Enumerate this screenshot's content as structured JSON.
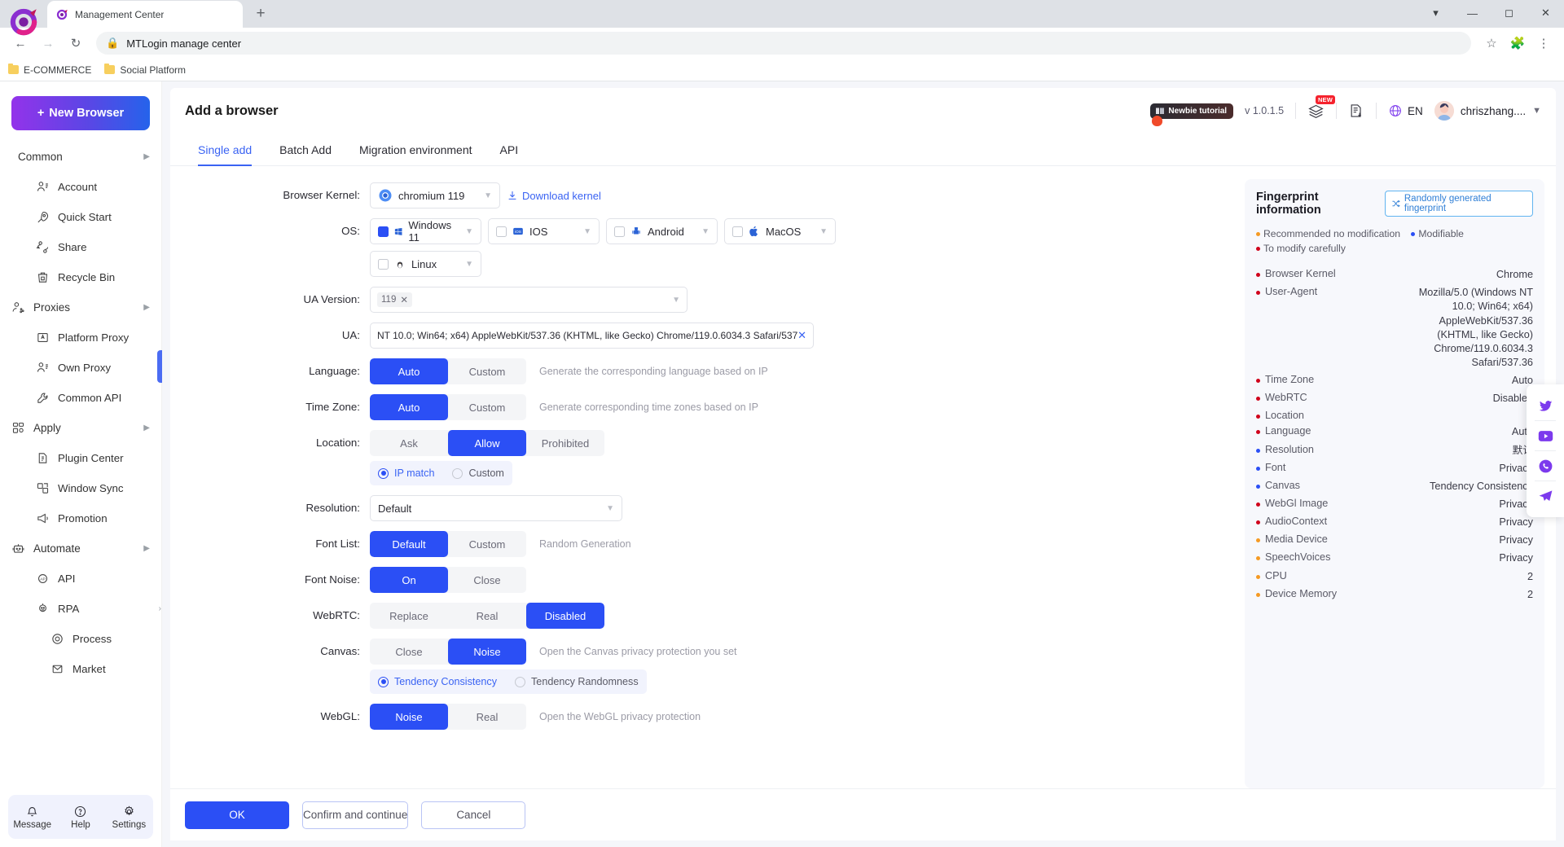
{
  "browser": {
    "tab_title": "Management Center",
    "new_tab_label": "+",
    "url": "MTLogin manage center",
    "bookmarks": [
      {
        "label": "E-COMMERCE"
      },
      {
        "label": "Social Platform"
      }
    ]
  },
  "sidebar": {
    "new_browser_label": "New Browser",
    "items": [
      {
        "label": "Common",
        "level": "group",
        "icon": "none",
        "expandable": true
      },
      {
        "label": "Account",
        "level": "item",
        "icon": "account-icon"
      },
      {
        "label": "Quick Start",
        "level": "item",
        "icon": "rocket-icon"
      },
      {
        "label": "Share",
        "level": "item",
        "icon": "share-icon"
      },
      {
        "label": "Recycle Bin",
        "level": "item",
        "icon": "recycle-bin-icon"
      },
      {
        "label": "Proxies",
        "level": "group",
        "icon": "proxies-icon",
        "expandable": true
      },
      {
        "label": "Platform Proxy",
        "level": "item",
        "icon": "platform-proxy-icon"
      },
      {
        "label": "Own Proxy",
        "level": "item",
        "icon": "own-proxy-icon"
      },
      {
        "label": "Common API",
        "level": "item",
        "icon": "wrench-icon"
      },
      {
        "label": "Apply",
        "level": "group",
        "icon": "apply-icon",
        "expandable": true
      },
      {
        "label": "Plugin Center",
        "level": "item",
        "icon": "plugin-icon"
      },
      {
        "label": "Window Sync",
        "level": "item",
        "icon": "window-sync-icon"
      },
      {
        "label": "Promotion",
        "level": "item",
        "icon": "megaphone-icon"
      },
      {
        "label": "Automate",
        "level": "group",
        "icon": "robot-icon",
        "expandable": true
      },
      {
        "label": "API",
        "level": "item",
        "icon": "api-icon"
      },
      {
        "label": "RPA",
        "level": "item",
        "icon": "rpa-icon",
        "expandable": true
      },
      {
        "label": "Process",
        "level": "lvl3",
        "icon": "process-icon"
      },
      {
        "label": "Market",
        "level": "lvl3",
        "icon": "market-icon"
      }
    ],
    "footer": [
      {
        "label": "Message",
        "icon": "bell-icon"
      },
      {
        "label": "Help",
        "icon": "question-icon"
      },
      {
        "label": "Settings",
        "icon": "gear-icon"
      }
    ]
  },
  "header": {
    "title": "Add a browser",
    "tutorial_label": "Newbie tutorial",
    "version": "v 1.0.1.5",
    "stack_badge": "NEW",
    "language": "EN",
    "user": "chriszhang...."
  },
  "tabs": [
    {
      "label": "Single add",
      "active": true
    },
    {
      "label": "Batch Add",
      "active": false
    },
    {
      "label": "Migration environment",
      "active": false
    },
    {
      "label": "API",
      "active": false
    }
  ],
  "form": {
    "browser_kernel": {
      "label": "Browser Kernel:",
      "value": "chromium 119",
      "download_label": "Download kernel"
    },
    "os": {
      "label": "OS:",
      "options": [
        {
          "name": "Windows 11",
          "checked": true,
          "icon": "windows-icon"
        },
        {
          "name": "IOS",
          "checked": false,
          "icon": "ios-icon"
        },
        {
          "name": "Android",
          "checked": false,
          "icon": "android-icon"
        },
        {
          "name": "MacOS",
          "checked": false,
          "icon": "apple-icon"
        },
        {
          "name": "Linux",
          "checked": false,
          "icon": "linux-icon"
        }
      ]
    },
    "ua_version": {
      "label": "UA Version:",
      "tag": "119"
    },
    "ua": {
      "label": "UA:",
      "value": "NT 10.0; Win64; x64) AppleWebKit/537.36 (KHTML, like Gecko) Chrome/119.0.6034.3 Safari/537.36"
    },
    "language": {
      "label": "Language:",
      "options": [
        "Auto",
        "Custom"
      ],
      "selected": "Auto",
      "hint": "Generate the corresponding language based on IP"
    },
    "timezone": {
      "label": "Time Zone:",
      "options": [
        "Auto",
        "Custom"
      ],
      "selected": "Auto",
      "hint": "Generate corresponding time zones based on IP"
    },
    "location": {
      "label": "Location:",
      "options": [
        "Ask",
        "Allow",
        "Prohibited"
      ],
      "selected": "Allow"
    },
    "location_mode": {
      "options": [
        "IP match",
        "Custom"
      ],
      "selected": "IP match"
    },
    "resolution": {
      "label": "Resolution:",
      "value": "Default"
    },
    "font_list": {
      "label": "Font List:",
      "options": [
        "Default",
        "Custom"
      ],
      "selected": "Default",
      "hint": "Random Generation"
    },
    "font_noise": {
      "label": "Font Noise:",
      "options": [
        "On",
        "Close"
      ],
      "selected": "On"
    },
    "webrtc": {
      "label": "WebRTC:",
      "options": [
        "Replace",
        "Real",
        "Disabled"
      ],
      "selected": "Disabled"
    },
    "canvas": {
      "label": "Canvas:",
      "options": [
        "Close",
        "Noise"
      ],
      "selected": "Noise",
      "hint": "Open the Canvas privacy protection you set"
    },
    "canvas_mode": {
      "options": [
        "Tendency Consistency",
        "Tendency Randomness"
      ],
      "selected": "Tendency Consistency"
    },
    "webgl": {
      "label": "WebGL:",
      "options": [
        "Noise",
        "Real"
      ],
      "selected": "Noise",
      "hint": "Open the WebGL privacy protection"
    }
  },
  "fingerprint": {
    "title": "Fingerprint information",
    "random_button": "Randomly generated fingerprint",
    "legend": [
      {
        "text": "Recommended no modification",
        "color": "#f59a23"
      },
      {
        "text": "Modifiable",
        "color": "#2b4ff5"
      },
      {
        "text": "To modify carefully",
        "color": "#d0021b"
      }
    ],
    "rows": [
      {
        "key": "Browser Kernel",
        "value": "Chrome",
        "color": "#d0021b"
      },
      {
        "key": "User-Agent",
        "value": "Mozilla/5.0 (Windows NT 10.0; Win64; x64) AppleWebKit/537.36 (KHTML, like Gecko) Chrome/119.0.6034.3 Safari/537.36",
        "color": "#d0021b"
      },
      {
        "key": "Time Zone",
        "value": "Auto",
        "color": "#d0021b"
      },
      {
        "key": "WebRTC",
        "value": "Disabled",
        "color": "#d0021b"
      },
      {
        "key": "Location",
        "value": "",
        "color": "#d0021b"
      },
      {
        "key": "Language",
        "value": "Auto",
        "color": "#d0021b"
      },
      {
        "key": "Resolution",
        "value": "默认",
        "color": "#2b4ff5"
      },
      {
        "key": "Font",
        "value": "Privacy",
        "color": "#2b4ff5"
      },
      {
        "key": "Canvas",
        "value": "Tendency Consistency",
        "color": "#2b4ff5"
      },
      {
        "key": "WebGl Image",
        "value": "Privacy",
        "color": "#d0021b"
      },
      {
        "key": "AudioContext",
        "value": "Privacy",
        "color": "#d0021b"
      },
      {
        "key": "Media Device",
        "value": "Privacy",
        "color": "#f59a23"
      },
      {
        "key": "SpeechVoices",
        "value": "Privacy",
        "color": "#f59a23"
      },
      {
        "key": "CPU",
        "value": "2",
        "color": "#f59a23"
      },
      {
        "key": "Device Memory",
        "value": "2",
        "color": "#f59a23"
      }
    ]
  },
  "social": [
    {
      "icon": "twitter-icon"
    },
    {
      "icon": "youtube-icon"
    },
    {
      "icon": "whatsapp-icon"
    },
    {
      "icon": "telegram-icon"
    }
  ],
  "footer": {
    "ok": "OK",
    "confirm_continue": "Confirm and continue",
    "cancel": "Cancel"
  }
}
